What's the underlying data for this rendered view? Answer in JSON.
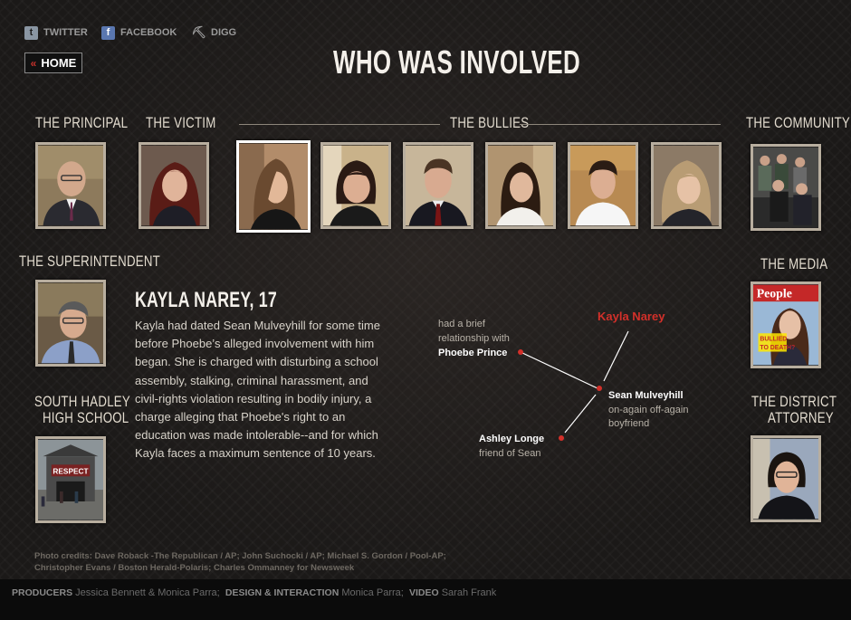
{
  "social": {
    "twitter_label": "TWITTER",
    "facebook_label": "FACEBOOK",
    "digg_label": "DIGG"
  },
  "nav": {
    "home_label": "HOME",
    "home_chevron": "«"
  },
  "title": "WHO WAS INVOLVED",
  "labels": {
    "principal": "THE PRINCIPAL",
    "victim": "THE VICTIM",
    "bullies": "THE BULLIES",
    "community": "THE COMMUNITY",
    "superintendent": "THE SUPERINTENDENT",
    "media": "THE MEDIA",
    "school_line1": "SOUTH HADLEY",
    "school_line2": "HIGH SCHOOL",
    "attorney_line1": "THE DISTRICT",
    "attorney_line2": "ATTORNEY"
  },
  "media_cover": {
    "masthead": "People",
    "headline_line1": "BULLIED",
    "headline_line2": "TO DEATH?"
  },
  "school_sign": "RESPECT",
  "profile": {
    "name": "KAYLA NAREY, 17",
    "bio": "Kayla had dated Sean Mulveyhill for some time before Phoebe’s alleged involvement with him began. She is charged with disturbing a school assembly, stalking, criminal harassment, and civil-rights violation resulting in bodily injury, a charge alleging that Phoebe's right to an education was made intolerable--and for which Kayla faces a maximum sentence of 10 years."
  },
  "relationships": {
    "center_name": "Kayla Narey",
    "phoebe_pre": "had a brief",
    "phoebe_pre2": "relationship with",
    "phoebe_name": "Phoebe Prince",
    "sean_name": "Sean Mulveyhill",
    "sean_desc1": "on-again off-again",
    "sean_desc2": "boyfriend",
    "ashley_name": "Ashley Longe",
    "ashley_desc": "friend of Sean"
  },
  "credits": "Photo credits: Dave Roback -The Republican / AP; John Suchocki / AP; Michael S. Gordon / Pool-AP; Christopher Evans / Boston Herald-Polaris; Charles Ommanney for Newsweek",
  "footer": {
    "producers_label": "PRODUCERS",
    "producers": "Jessica Bennett & Monica Parra;",
    "design_label": "DESIGN & INTERACTION",
    "design": "Monica Parra;",
    "video_label": "VIDEO",
    "video": "Sarah Frank"
  },
  "colors": {
    "accent_red": "#d3302a",
    "frame": "#b8ae9f",
    "selected_frame": "#ffffff"
  }
}
